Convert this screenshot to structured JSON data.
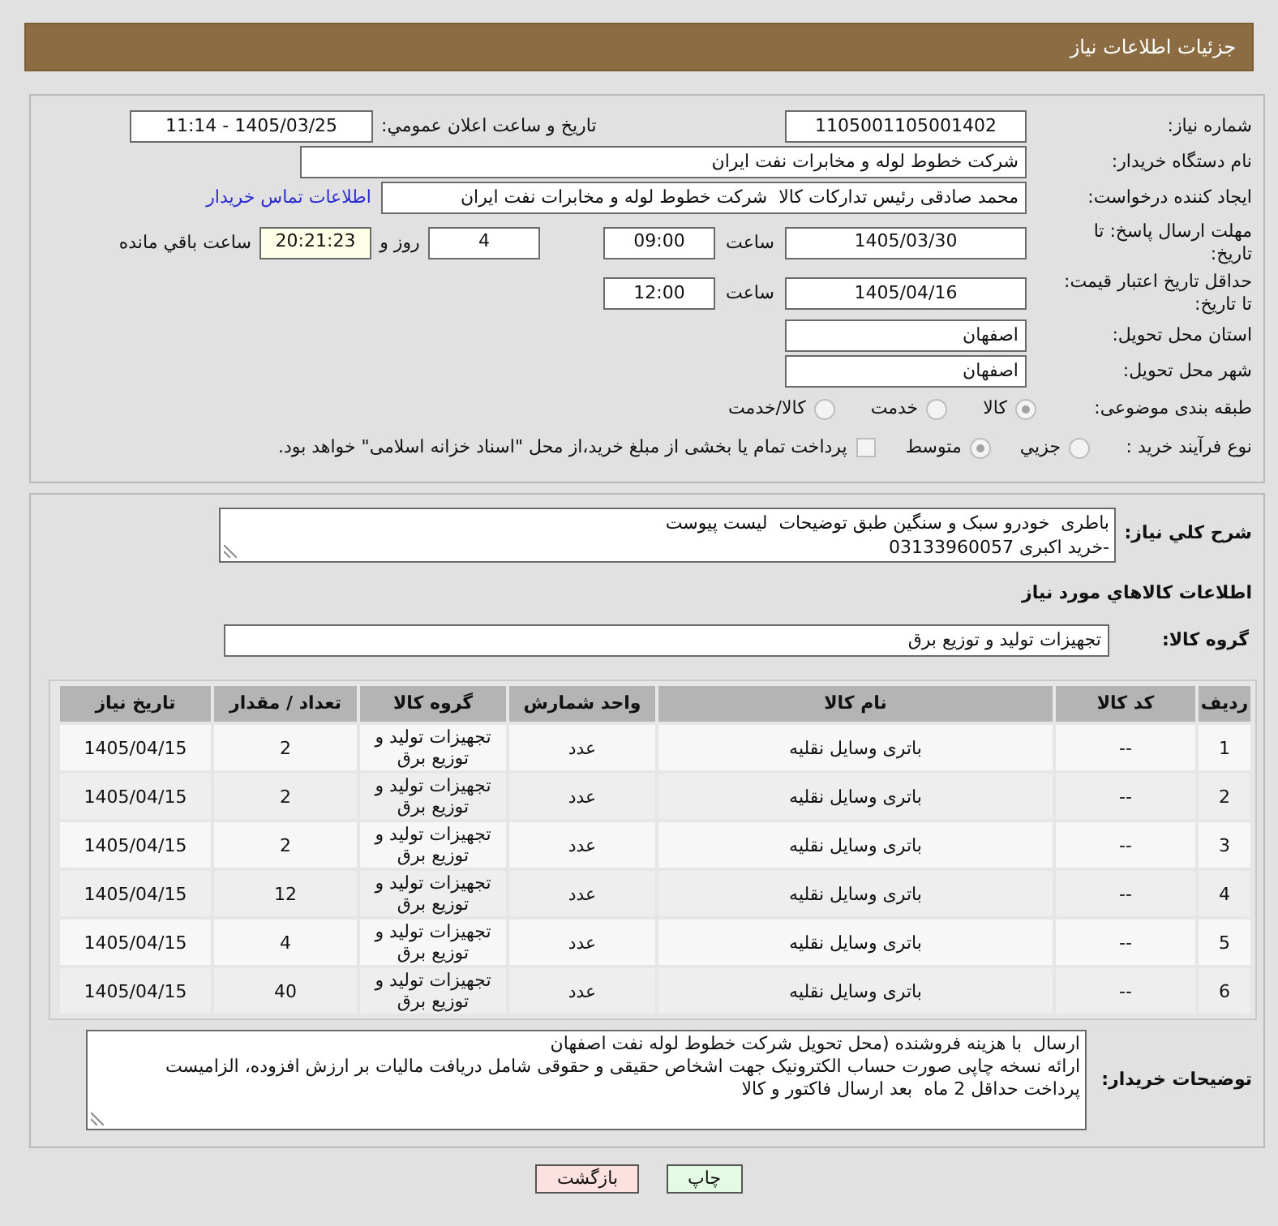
{
  "header": {
    "title": "جزئیات اطلاعات نیاز"
  },
  "details": {
    "need_number": {
      "label": "شماره نیاز:",
      "value": "1105001105001402"
    },
    "announce": {
      "label": "تاریخ و ساعت اعلان عمومي:",
      "value": "1405/03/25 - 11:14"
    },
    "buyer_org": {
      "label": "نام دستگاه خریدار:",
      "value": "شرکت خطوط لوله و مخابرات نفت ایران"
    },
    "requester": {
      "label": "ایجاد کننده درخواست:",
      "value": "محمد صادقی رئیس تدارکات کالا  شرکت خطوط لوله و مخابرات نفت ایران",
      "link": "اطلاعات تماس خریدار"
    },
    "reply_deadline": {
      "label": "مهلت ارسال پاسخ: تا تاریخ:",
      "date": "1405/03/30",
      "time_label": "ساعت",
      "time": "09:00",
      "days": "4",
      "days_label": "روز و",
      "remaining": "20:21:23",
      "remaining_label": "ساعت باقي مانده"
    },
    "price_validity": {
      "label": "حداقل تاریخ اعتبار قیمت: تا تاریخ:",
      "date": "1405/04/16",
      "time_label": "ساعت",
      "time": "12:00"
    },
    "province": {
      "label": "استان محل تحویل:",
      "value": "اصفهان"
    },
    "city": {
      "label": "شهر محل تحویل:",
      "value": "اصفهان"
    },
    "category": {
      "label": "طبقه بندی موضوعی:",
      "options": [
        {
          "label": "کالا",
          "selected": true
        },
        {
          "label": "خدمت",
          "selected": false
        },
        {
          "label": "کالا/خدمت",
          "selected": false
        }
      ]
    },
    "process": {
      "label": "نوع فرآیند خرید :",
      "options": [
        {
          "label": "جزيي",
          "selected": false
        },
        {
          "label": "متوسط",
          "selected": true
        }
      ],
      "treasury": {
        "label": "پرداخت تمام یا بخشی از مبلغ خرید،از محل \"اسناد خزانه اسلامی\" خواهد بود.",
        "checked": false
      }
    }
  },
  "description": {
    "label": "شرح کلي نیاز:",
    "lines": [
      "باطری  خودرو سبک و سنگین طبق توضیحات  لیست پیوست",
      "-خرید اکبری 03133960057"
    ]
  },
  "goods": {
    "title": "اطلاعات کالاهاي مورد نیاز",
    "group": {
      "label": "گروه کالا:",
      "value": "تجهیزات تولید و توزیع برق"
    }
  },
  "table": {
    "columns": [
      "ردیف",
      "کد کالا",
      "نام کالا",
      "واحد شمارش",
      "گروه کالا",
      "تعداد / مقدار",
      "تاریخ نیاز"
    ],
    "rows": [
      [
        "1",
        "--",
        "باتری وسایل نقلیه",
        "عدد",
        "تجهیزات تولید و توزیع برق",
        "2",
        "1405/04/15"
      ],
      [
        "2",
        "--",
        "باتری وسایل نقلیه",
        "عدد",
        "تجهیزات تولید و توزیع برق",
        "2",
        "1405/04/15"
      ],
      [
        "3",
        "--",
        "باتری وسایل نقلیه",
        "عدد",
        "تجهیزات تولید و توزیع برق",
        "2",
        "1405/04/15"
      ],
      [
        "4",
        "--",
        "باتری وسایل نقلیه",
        "عدد",
        "تجهیزات تولید و توزیع برق",
        "12",
        "1405/04/15"
      ],
      [
        "5",
        "--",
        "باتری وسایل نقلیه",
        "عدد",
        "تجهیزات تولید و توزیع برق",
        "4",
        "1405/04/15"
      ],
      [
        "6",
        "--",
        "باتری وسایل نقلیه",
        "عدد",
        "تجهیزات تولید و توزیع برق",
        "40",
        "1405/04/15"
      ]
    ]
  },
  "buyer_notes": {
    "label": "توضیحات خریدار:",
    "lines": [
      "ارسال  با هزینه فروشنده (محل تحویل شرکت خطوط لوله نفت اصفهان",
      "ارائه نسخه چاپی صورت حساب الکترونیک جهت اشخاص حقیقی و حقوقی شامل دریافت مالیات بر ارزش افزوده، الزامیست",
      "پرداخت حداقل 2 ماه  بعد ارسال فاکتور و کالا"
    ]
  },
  "buttons": [
    {
      "label": "چاپ",
      "kind": "print"
    },
    {
      "label": "بازگشت",
      "kind": "back"
    }
  ]
}
